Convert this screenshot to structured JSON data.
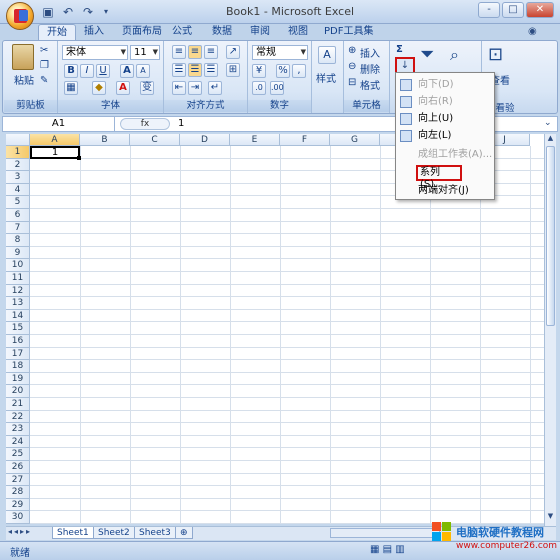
{
  "window": {
    "title": "Book1 - Microsoft Excel",
    "controls": [
      "-",
      "□",
      "✕"
    ]
  },
  "tabs": [
    "开始",
    "插入",
    "页面布局",
    "公式",
    "数据",
    "审阅",
    "视图",
    "PDF工具集"
  ],
  "ribbon": {
    "clipboard": {
      "label": "剪贴板",
      "paste": "粘贴"
    },
    "font": {
      "label": "字体",
      "name": "宋体",
      "size": "11",
      "bold": "B",
      "italic": "I",
      "underline": "U",
      "grow": "A",
      "shrink": "A",
      "color_letter": "A",
      "wen": "变"
    },
    "alignment": {
      "label": "对齐方式"
    },
    "number": {
      "label": "数字",
      "format": "常规",
      "percent": "%",
      "comma": ","
    },
    "styles": {
      "label": "样式"
    },
    "cells": {
      "label": "单元格",
      "insert": "插入",
      "delete": "删除",
      "format": "格式"
    },
    "editing": {
      "label": "编辑",
      "sigma": "Σ",
      "sort": "排序和",
      "find": "查找和",
      "partial_label": "查看",
      "partial_group": "查看验"
    }
  },
  "formula_bar": {
    "name_box": "A1",
    "fx": "fx",
    "value": "1"
  },
  "grid": {
    "columns": [
      "A",
      "B",
      "C",
      "D",
      "E",
      "F",
      "G",
      "H",
      "I",
      "J"
    ],
    "rows": [
      "1",
      "2",
      "3",
      "4",
      "5",
      "6",
      "7",
      "8",
      "9",
      "10",
      "11",
      "12",
      "13",
      "14",
      "15",
      "16",
      "17",
      "18",
      "19",
      "20",
      "21",
      "22",
      "23",
      "24",
      "25",
      "26",
      "27",
      "28",
      "29",
      "30"
    ],
    "a1_value": "1"
  },
  "fill_menu": {
    "items": [
      {
        "label": "向下(D)",
        "enabled": false
      },
      {
        "label": "向右(R)",
        "enabled": false
      },
      {
        "label": "向上(U)",
        "enabled": true
      },
      {
        "label": "向左(L)",
        "enabled": true
      },
      {
        "label": "成组工作表(A)...",
        "enabled": false
      },
      {
        "label": "系列(S)...",
        "enabled": true,
        "highlighted": true
      },
      {
        "label": "两端对齐(J)",
        "enabled": true
      }
    ]
  },
  "sheets": [
    "Sheet1",
    "Sheet2",
    "Sheet3"
  ],
  "status": {
    "text": "就绪"
  },
  "watermark": {
    "brand": "电脑软硬件教程网",
    "url": "www.computer26.com"
  },
  "colors": {
    "highlight": "#d01010",
    "ribbon": "#dbe7f6",
    "selected_col": "#f9d88e"
  }
}
